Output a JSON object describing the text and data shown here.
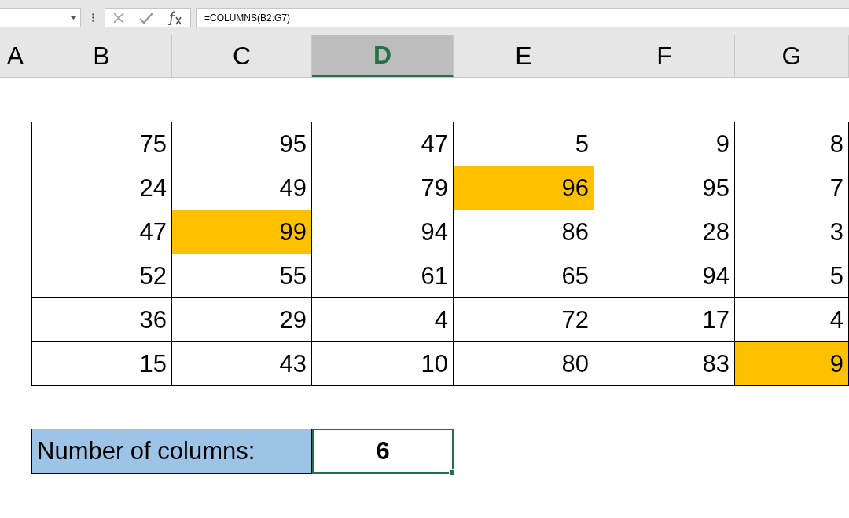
{
  "formula_bar": {
    "formula": "=COLUMNS(B2:G7)"
  },
  "column_headers": [
    {
      "label": "A",
      "selected": false
    },
    {
      "label": "B",
      "selected": false
    },
    {
      "label": "C",
      "selected": false
    },
    {
      "label": "D",
      "selected": true
    },
    {
      "label": "E",
      "selected": false
    },
    {
      "label": "F",
      "selected": false
    },
    {
      "label": "G",
      "selected": false
    }
  ],
  "table": {
    "rows": [
      {
        "cells": [
          {
            "value": "75",
            "highlighted": false
          },
          {
            "value": "95",
            "highlighted": false
          },
          {
            "value": "47",
            "highlighted": false
          },
          {
            "value": "5",
            "highlighted": false
          },
          {
            "value": "9",
            "highlighted": false
          },
          {
            "value": "8",
            "highlighted": false
          }
        ]
      },
      {
        "cells": [
          {
            "value": "24",
            "highlighted": false
          },
          {
            "value": "49",
            "highlighted": false
          },
          {
            "value": "79",
            "highlighted": false
          },
          {
            "value": "96",
            "highlighted": true
          },
          {
            "value": "95",
            "highlighted": false
          },
          {
            "value": "7",
            "highlighted": false
          }
        ]
      },
      {
        "cells": [
          {
            "value": "47",
            "highlighted": false
          },
          {
            "value": "99",
            "highlighted": true
          },
          {
            "value": "94",
            "highlighted": false
          },
          {
            "value": "86",
            "highlighted": false
          },
          {
            "value": "28",
            "highlighted": false
          },
          {
            "value": "3",
            "highlighted": false
          }
        ]
      },
      {
        "cells": [
          {
            "value": "52",
            "highlighted": false
          },
          {
            "value": "55",
            "highlighted": false
          },
          {
            "value": "61",
            "highlighted": false
          },
          {
            "value": "65",
            "highlighted": false
          },
          {
            "value": "94",
            "highlighted": false
          },
          {
            "value": "5",
            "highlighted": false
          }
        ]
      },
      {
        "cells": [
          {
            "value": "36",
            "highlighted": false
          },
          {
            "value": "29",
            "highlighted": false
          },
          {
            "value": "4",
            "highlighted": false
          },
          {
            "value": "72",
            "highlighted": false
          },
          {
            "value": "17",
            "highlighted": false
          },
          {
            "value": "4",
            "highlighted": false
          }
        ]
      },
      {
        "cells": [
          {
            "value": "15",
            "highlighted": false
          },
          {
            "value": "43",
            "highlighted": false
          },
          {
            "value": "10",
            "highlighted": false
          },
          {
            "value": "80",
            "highlighted": false
          },
          {
            "value": "83",
            "highlighted": false
          },
          {
            "value": "9",
            "highlighted": true
          }
        ]
      }
    ]
  },
  "result": {
    "label": "Number of columns:",
    "value": "6",
    "selected": true
  }
}
